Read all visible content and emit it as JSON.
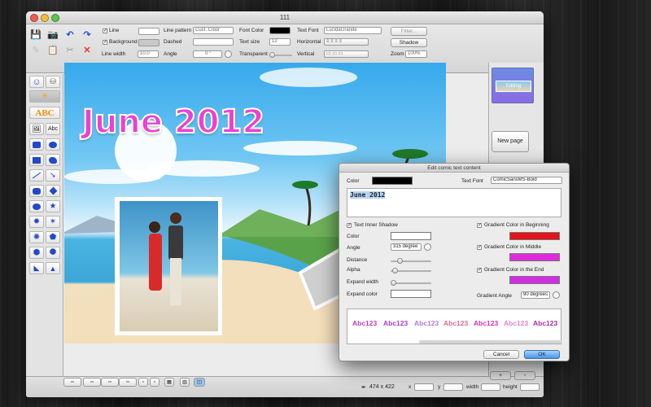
{
  "window": {
    "title": "111"
  },
  "toolbar": {
    "line_label": "Line",
    "background_label": "Background",
    "line_width_label": "Line width",
    "line_width_value": "10.0",
    "line_pattern_label": "Line pattern",
    "line_pattern_value": "Cust. Color",
    "dashed_label": "Dashed",
    "angle_label": "Angle",
    "angle_value": "0 °",
    "font_color_label": "Font Color",
    "text_size_label": "Text size",
    "text_size_value": "12",
    "transparent_label": "Transparent",
    "text_font_label": "Text Font",
    "text_font_value": "LucidaGrande",
    "horizontal_label": "Horizontal",
    "vertical_label": "Vertical",
    "filter_label": "Filter...",
    "shadow_label": "Shadow",
    "zoom_label": "Zoom",
    "zoom_value": "100%",
    "font_color": "#000000"
  },
  "leftbar": {
    "abc_big": "ABC",
    "abc_small": "Abc"
  },
  "canvas": {
    "headline": "June 2012"
  },
  "rightpanel": {
    "thumb_label": "Editing",
    "new_page_label": "New page",
    "add_label": "+",
    "remove_label": "×"
  },
  "statusbar": {
    "size_value": "474 x 422",
    "x_label": "x",
    "y_label": "y",
    "width_label": "width",
    "height_label": "height"
  },
  "dialog": {
    "title": "Edit comic text content",
    "color_label": "Color",
    "text_font_label": "Text Font",
    "text_font_value": "ComicSansMS-Bold",
    "text_value": "June 2012",
    "inner_shadow_label": "Text Inner Shadow",
    "shadow_color_label": "Color",
    "angle_label": "Angle",
    "angle_value": "315 degree",
    "distance_label": "Distance",
    "alpha_label": "Alpha",
    "expand_width_label": "Expand width",
    "expand_color_label": "Expand color",
    "grad_begin_label": "Gradient Color in Beginning",
    "grad_middle_label": "Gradient Color in Middle",
    "grad_end_label": "Gradient Color in the End",
    "grad_angle_label": "Gradient Angle",
    "grad_angle_value": "90 degrees",
    "samples": [
      "Abc123",
      "Abc123",
      "Abc123",
      "Abc123",
      "Abc123",
      "Abc123",
      "Abc123"
    ],
    "cancel_label": "Cancel",
    "ok_label": "OK",
    "colors": {
      "text": "#000000",
      "begin": "#e3141c",
      "middle": "#e12adb",
      "end": "#d12ee2"
    }
  }
}
